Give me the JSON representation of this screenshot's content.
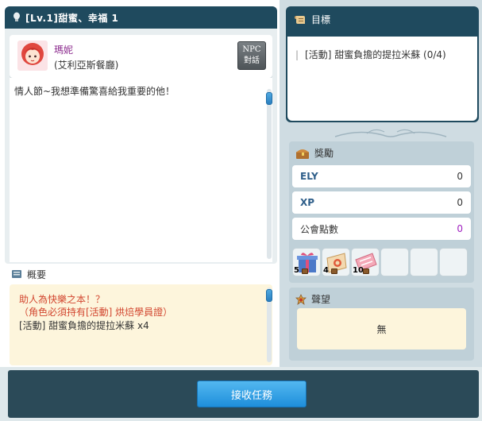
{
  "quest": {
    "title": "[Lv.1]甜蜜、幸福 1"
  },
  "npc": {
    "name": "瑪妮",
    "location": "(艾利亞斯餐廳)",
    "talk_button_line1": "NPC",
    "talk_button_line2": "對話",
    "dialog": "情人節~我想準備驚喜給我重要的他！"
  },
  "summary": {
    "header": "概要",
    "line1": "助人為快樂之本！？",
    "line2": "（角色必須持有[活動] 烘焙學員證）",
    "line3": "[活動] 甜蜜負擔的提拉米蘇 x4"
  },
  "goal": {
    "header": "目標",
    "item": "[活動] 甜蜜負擔的提拉米蘇 (0/4)"
  },
  "reward": {
    "header": "獎勵",
    "rows": [
      {
        "label": "ELY",
        "value": "0"
      },
      {
        "label": "XP",
        "value": "0"
      },
      {
        "label": "公會點數",
        "value": "0"
      }
    ],
    "items": [
      {
        "icon": "gift-box-icon",
        "qty": "5"
      },
      {
        "icon": "scroll-icon",
        "qty": "4"
      },
      {
        "icon": "ticket-icon",
        "qty": "10"
      },
      {
        "icon": "empty-slot",
        "qty": ""
      },
      {
        "icon": "empty-slot",
        "qty": ""
      },
      {
        "icon": "empty-slot",
        "qty": ""
      }
    ]
  },
  "fame": {
    "header": "聲望",
    "value": "無"
  },
  "actions": {
    "accept_label": "接收任務"
  },
  "colors": {
    "header_dark": "#1f4a5e",
    "accent_red": "#d2462f",
    "button_blue": "#1e8edb",
    "purple_value": "#a020c0",
    "npc_name": "#8b2a8d"
  }
}
